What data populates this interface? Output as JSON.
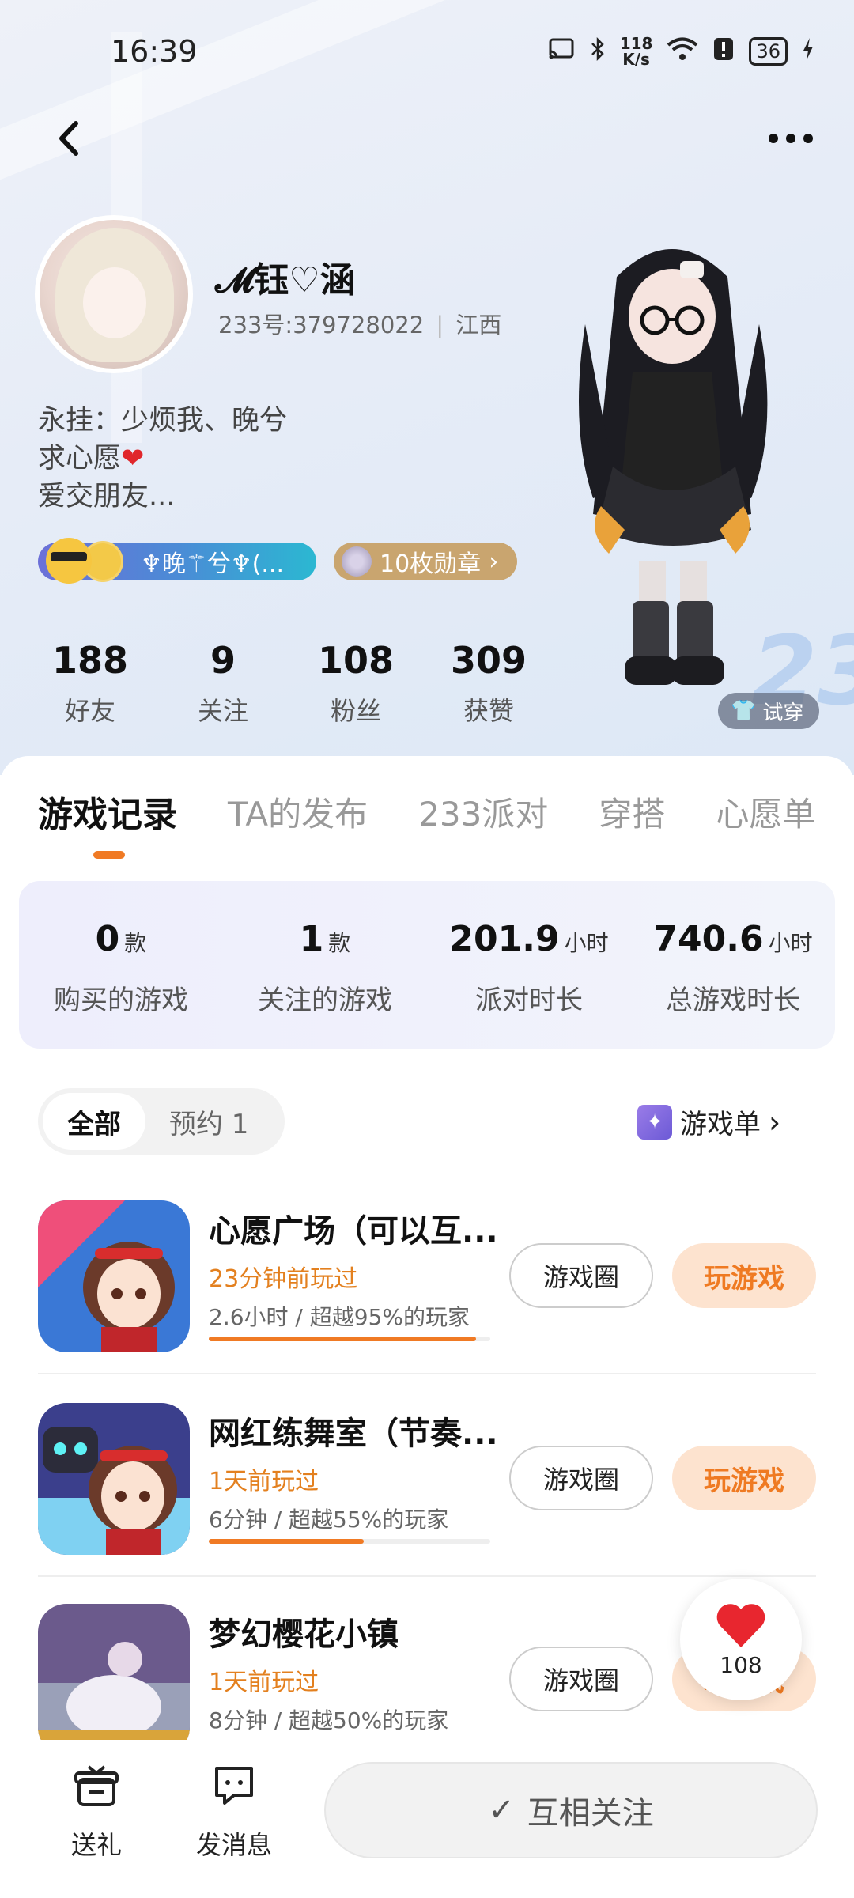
{
  "status_bar": {
    "time": "16:39",
    "net_speed_value": "118",
    "net_speed_unit": "K/s",
    "battery": "36"
  },
  "profile": {
    "username": "𝓜钰♡涵",
    "user_id": "233号:379728022",
    "region": "江西",
    "bio": [
      "永挂：少烦我、晚兮",
      "求心愿",
      "爱交朋友..."
    ],
    "nick_badge": "♆晚⚚兮♆(...",
    "medal_badge": "10枚勋章",
    "try_on": "试穿",
    "stats": [
      {
        "value": "188",
        "label": "好友"
      },
      {
        "value": "9",
        "label": "关注"
      },
      {
        "value": "108",
        "label": "粉丝"
      },
      {
        "value": "309",
        "label": "获赞"
      }
    ]
  },
  "tabs": [
    "游戏记录",
    "TA的发布",
    "233派对",
    "穿搭",
    "心愿单"
  ],
  "summary": [
    {
      "value": "0",
      "unit": "款",
      "label": "购买的游戏"
    },
    {
      "value": "1",
      "unit": "款",
      "label": "关注的游戏"
    },
    {
      "value": "201.9",
      "unit": "小时",
      "label": "派对时长"
    },
    {
      "value": "740.6",
      "unit": "小时",
      "label": "总游戏时长"
    }
  ],
  "filter": {
    "all": "全部",
    "reserved": "预约 1",
    "game_list": "游戏单"
  },
  "games": [
    {
      "title": "心愿广场（可以互...",
      "played": "23分钟前玩过",
      "meta": "2.6小时 / 超越95%的玩家",
      "progress": 0.95,
      "circle_btn": "游戏圈",
      "play_btn": "玩游戏"
    },
    {
      "title": "网红练舞室（节奏...",
      "played": "1天前玩过",
      "meta": "6分钟 / 超越55%的玩家",
      "progress": 0.55,
      "circle_btn": "游戏圈",
      "play_btn": "玩游戏"
    },
    {
      "title": "梦幻樱花小镇",
      "played": "1天前玩过",
      "meta": "8分钟 / 超越50%的玩家",
      "progress": 0.5,
      "circle_btn": "游戏圈",
      "play_btn": "玩游戏"
    }
  ],
  "like_float": {
    "count": "108"
  },
  "bottom_bar": {
    "gift": "送礼",
    "message": "发消息",
    "follow": "互相关注"
  },
  "colors": {
    "accent": "#f07a24",
    "accent_light": "#fde3cf",
    "heart": "#e8262f"
  }
}
